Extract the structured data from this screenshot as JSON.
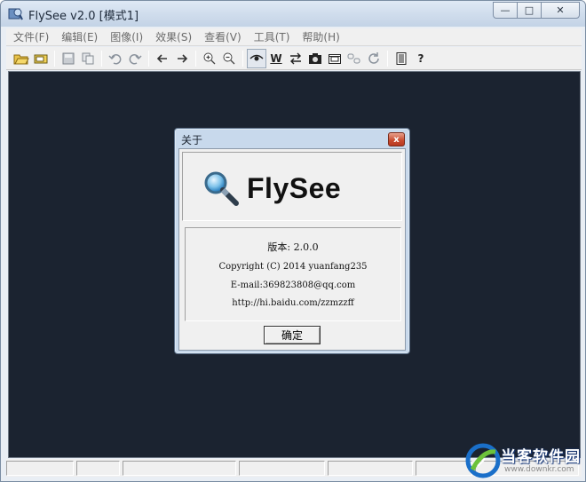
{
  "window": {
    "title": "FlySee v2.0 [模式1]",
    "minimize_glyph": "—",
    "maximize_glyph": "□",
    "close_glyph": "✕"
  },
  "menubar": {
    "items": [
      {
        "label": "文件(F)"
      },
      {
        "label": "编辑(E)"
      },
      {
        "label": "图像(I)"
      },
      {
        "label": "效果(S)"
      },
      {
        "label": "查看(V)"
      },
      {
        "label": "工具(T)"
      },
      {
        "label": "帮助(H)"
      }
    ]
  },
  "toolbar": {
    "icons": [
      "open-folder-icon",
      "open-file-icon",
      "save-icon",
      "copy-icon",
      "undo-icon",
      "redo-icon",
      "arrow-left-icon",
      "arrow-right-icon",
      "zoom-in-icon",
      "zoom-out-icon",
      "eye-icon",
      "w-icon",
      "arrows-icon",
      "camera-icon",
      "frame-icon",
      "chain-icon",
      "refresh-icon",
      "document-icon",
      "help-icon"
    ],
    "w_glyph": "W",
    "help_glyph": "?"
  },
  "about_dialog": {
    "title": "关于",
    "close_glyph": "x",
    "logo_text": "FlySee",
    "version": "版本: 2.0.0",
    "copyright": "Copyright (C) 2014 yuanfang235",
    "email": "E-mail:369823808@qq.com",
    "url": "http://hi.baidu.com/zzmzzff",
    "ok_label": "确定"
  },
  "watermark": {
    "brand": "当客软件园",
    "url": "www.downkr.com"
  },
  "colors": {
    "canvas": "#1b2330",
    "dialog_frame": "#c8d9ec",
    "watermark_blue": "#1a6fc9",
    "watermark_green": "#6cc23a"
  }
}
